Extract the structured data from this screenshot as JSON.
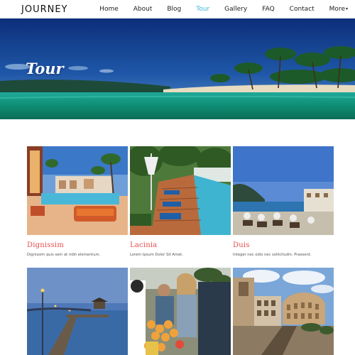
{
  "header": {
    "logo": "JOURNEY",
    "nav": [
      {
        "label": "Home",
        "active": false
      },
      {
        "label": "About",
        "active": false
      },
      {
        "label": "Blog",
        "active": false
      },
      {
        "label": "Tour",
        "active": true
      },
      {
        "label": "Gallery",
        "active": false
      },
      {
        "label": "FAQ",
        "active": false
      },
      {
        "label": "Contact",
        "active": false
      },
      {
        "label": "More",
        "active": false,
        "dropdown": true
      }
    ]
  },
  "hero": {
    "title": "Tour"
  },
  "tours": [
    {
      "title": "Dignissim",
      "description": "Dignissim quis sem at nibh elementum."
    },
    {
      "title": "Lacinia",
      "description": "Lorem Ipsum Dolor Sit Amet."
    },
    {
      "title": "Duis",
      "description": "Integer nec odio nec sollicitudin. Praesent."
    },
    {
      "title": "",
      "description": ""
    },
    {
      "title": "",
      "description": ""
    },
    {
      "title": "",
      "description": ""
    }
  ],
  "colors": {
    "accent": "#39b7d8",
    "card_title": "#e34b4b",
    "text": "#222222"
  }
}
